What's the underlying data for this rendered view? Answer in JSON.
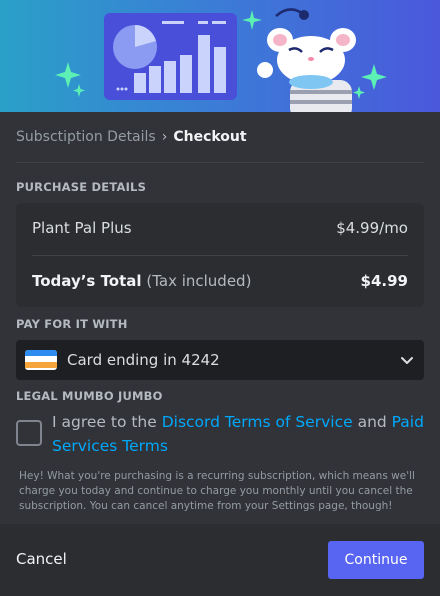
{
  "breadcrumb": {
    "previous": "Subsctiption Details",
    "separator": "›",
    "current": "Checkout"
  },
  "purchase": {
    "label": "PURCHASE DETAILS",
    "item_name": "Plant Pal Plus",
    "item_price": "$4.99/mo",
    "total_label": "Today’s Total",
    "total_note": "(Tax included)",
    "total_price": "$4.99"
  },
  "payment": {
    "label": "PAY FOR IT WITH",
    "selected": "Card ending in 4242"
  },
  "legal": {
    "label": "LEGAL MUMBO JUMBO",
    "agree_prefix": "I agree to the ",
    "tos_link": "Discord Terms of Service",
    "agree_and": " and ",
    "paid_link": "Paid Services Terms",
    "fine_print": "Hey! What you're purchasing is a recurring subscription, which means we'll charge you today and continue to charge you monthly until you cancel the subscription. You can cancel anytime from your Settings page, though!"
  },
  "footer": {
    "cancel_label": "Cancel",
    "continue_label": "Continue"
  },
  "colors": {
    "accent": "#5865f2",
    "link": "#00a8fc",
    "background": "#313338"
  }
}
